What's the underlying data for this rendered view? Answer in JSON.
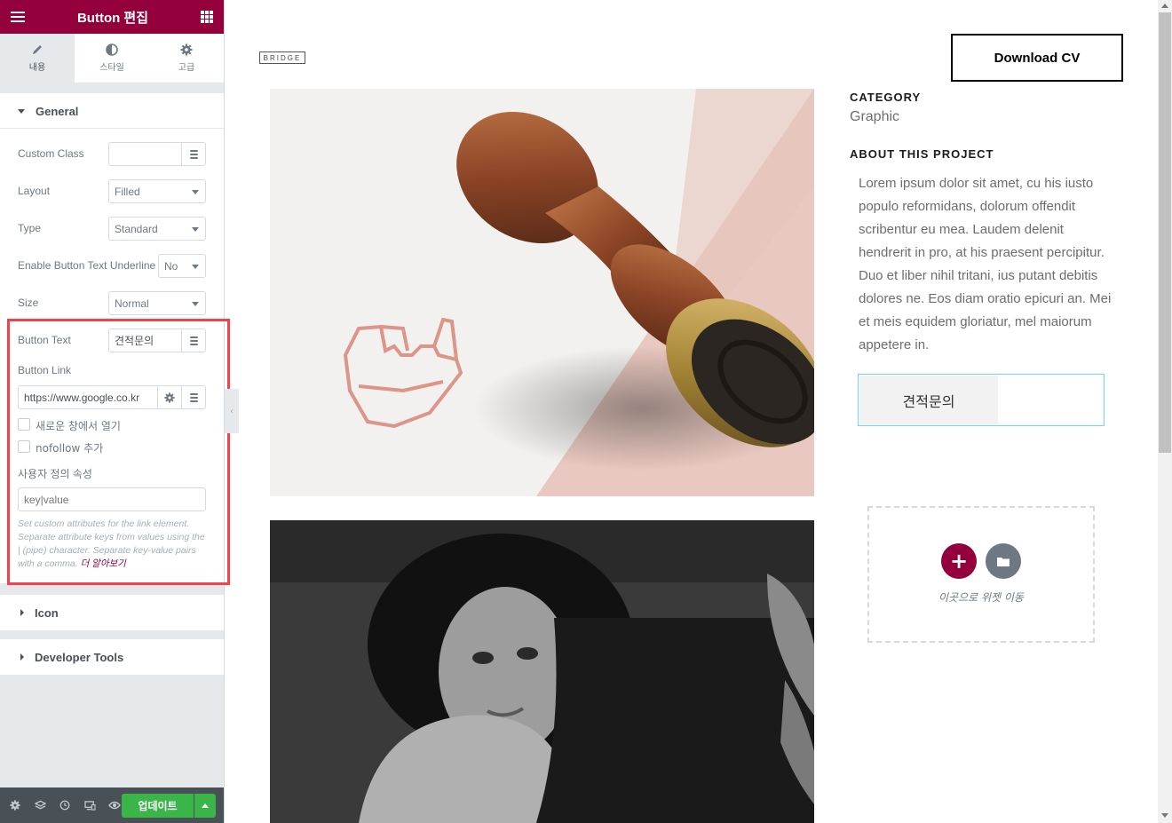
{
  "panel": {
    "title": "Button 편집",
    "tabs": [
      {
        "label": "내용",
        "icon": "pencil-icon"
      },
      {
        "label": "스타일",
        "icon": "contrast-icon"
      },
      {
        "label": "고급",
        "icon": "gear-icon"
      }
    ],
    "sections": {
      "general": "General",
      "icon": "Icon",
      "developer_tools": "Developer Tools"
    },
    "controls": {
      "custom_class_label": "Custom Class",
      "custom_class_value": "",
      "layout_label": "Layout",
      "layout_value": "Filled",
      "type_label": "Type",
      "type_value": "Standard",
      "underline_label": "Enable Button Text Underline",
      "underline_value": "No",
      "size_label": "Size",
      "size_value": "Normal",
      "button_text_label": "Button Text",
      "button_text_value": "견적문의",
      "button_link_label": "Button Link",
      "button_link_value": "https://www.google.co.kr",
      "new_window_label": "새로운 창에서 열기",
      "nofollow_label": "nofollow 추가",
      "custom_attr_label": "사용자 정의 속성",
      "custom_attr_placeholder": "key|value",
      "help_text": "Set custom attributes for the link element. Separate attribute keys from values using the | (pipe) character. Separate key-value pairs with a comma.",
      "help_link": "더 알아보기"
    },
    "footer": {
      "update_label": "업데이트",
      "icons": [
        "gear-icon",
        "layers-icon",
        "history-icon",
        "responsive-icon",
        "eye-icon"
      ]
    }
  },
  "preview": {
    "logo": "BRIDGE",
    "download_cv": "Download CV",
    "category_title": "CATEGORY",
    "category_value": "Graphic",
    "about_title": "ABOUT THIS PROJECT",
    "about_text": "Lorem ipsum dolor sit amet, cu his iusto populo reformidans, dolorum offendit scribentur eu mea. Laudem delenit hendrerit in pro, at his praesent percipitur. Duo et liber nihil tritani, ius putant debitis dolores ne. Eos diam oratio epicuri an. Mei et meis equidem gloriatur, mel maiorum appetere in.",
    "quote_button": "견적문의",
    "drop_zone_text": "이곳으로 위젯 이동"
  },
  "colors": {
    "brand": "#93003c",
    "update_green": "#39b54a",
    "highlight_red": "#f4424b",
    "selection_blue": "#71d7f7"
  }
}
